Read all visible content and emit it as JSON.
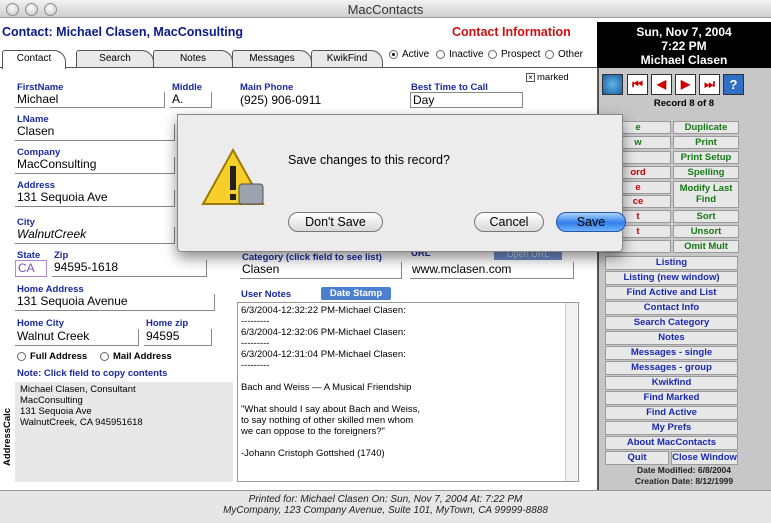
{
  "window": {
    "title": "MacContacts"
  },
  "header": {
    "contact": "Contact: Michael Clasen, MacConsulting",
    "section": "Contact Information"
  },
  "tabs": [
    "Contact",
    "Search",
    "Notes",
    "Messages",
    "KwikFind"
  ],
  "status": {
    "options": [
      "Active",
      "Inactive",
      "Prospect",
      "Other"
    ],
    "selected": "Active",
    "marked": "marked"
  },
  "fields": {
    "firstname": {
      "label": "FirstName",
      "value": "Michael"
    },
    "middle": {
      "label": "Middle",
      "value": "A."
    },
    "main_phone": {
      "label": "Main Phone",
      "value": "(925) 906-0911"
    },
    "best_time": {
      "label": "Best Time to Call",
      "value": "Day"
    },
    "lname": {
      "label": "LName",
      "value": "Clasen"
    },
    "company": {
      "label": "Company",
      "value": "MacConsulting"
    },
    "address": {
      "label": "Address",
      "value": "131 Sequoia Ave"
    },
    "city": {
      "label": "City",
      "value": "WalnutCreek"
    },
    "state": {
      "label": "State",
      "value": "CA"
    },
    "zip": {
      "label": "Zip",
      "value": "94595-1618"
    },
    "category": {
      "label": "Category (click field to see list)",
      "value": "Clasen"
    },
    "url": {
      "label": "URL",
      "value": "www.mclasen.com",
      "button": "Open URL"
    },
    "home_address": {
      "label": "Home Address",
      "value": "131 Sequoia Avenue"
    },
    "home_city": {
      "label": "Home City",
      "value": "Walnut Creek"
    },
    "home_zip": {
      "label": "Home zip",
      "value": "94595"
    }
  },
  "address_options": [
    "Full Address",
    "Mail Address"
  ],
  "note_copy": "Note: Click field to copy contents",
  "address_calc": {
    "side_label": "AddressCalc",
    "lines": [
      "Michael Clasen, Consultant",
      "MacConsulting",
      "131 Sequoia Ave",
      "WalnutCreek, CA 945951618"
    ]
  },
  "user_notes": {
    "label": "User Notes",
    "button": "Date Stamp",
    "text": "6/3/2004-12:32:22 PM-Michael Clasen:\n---------\n6/3/2004-12:32:06 PM-Michael Clasen:\n---------\n6/3/2004-12:31:04 PM-Michael Clasen:\n---------\n\nBach and Weiss — A Musical Friendship\n\n\"What should I say about Bach and Weiss,\nto say nothing of other skilled men whom\nwe can oppose to the foreigners?\"\n\n-Johann Cristoph Gottshed (1740)"
  },
  "sidebar": {
    "date": "Sun, Nov 7, 2004",
    "time": "7:22 PM",
    "user": "Michael Clasen",
    "record": "Record 8 of 8",
    "grid_left": [
      "e",
      "w",
      "",
      "ord",
      "e",
      "ce",
      "t",
      "t",
      ""
    ],
    "grid_right": [
      "Duplicate",
      "Print",
      "Print Setup",
      "Spelling",
      "Modify Last Find",
      "Sort",
      "Unsort",
      "Omit Mult"
    ],
    "buttons": [
      "Listing",
      "Listing (new window)",
      "Find Active and List",
      "Contact Info",
      "Search Category",
      "Notes",
      "Messages - single",
      "Messages - group",
      "Kwikfind",
      "Find Marked",
      "Find Active",
      "My Prefs",
      "About MacContacts"
    ],
    "quit": "Quit",
    "close": "Close Window",
    "modified": "Date Modified: 6/8/2004",
    "created": "Creation Date: 8/12/1999"
  },
  "footer": {
    "line1": "Printed for: Michael Clasen  On: Sun, Nov 7, 2004   At: 7:22 PM",
    "line2": "MyCompany, 123 Company Avenue, Suite 101, MyTown, CA   99999-8888"
  },
  "dialog": {
    "message": "Save changes to this record?",
    "dont_save": "Don't Save",
    "cancel": "Cancel",
    "save": "Save"
  }
}
